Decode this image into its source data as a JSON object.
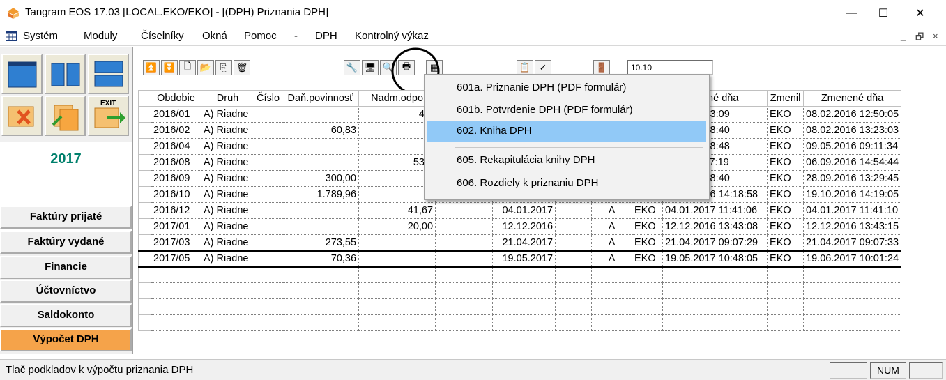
{
  "window": {
    "title": "Tangram EOS 17.03 [LOCAL.EKO/EKO] - [(DPH) Priznania DPH]",
    "minimize": "—",
    "maximize": "☐",
    "close": "✕"
  },
  "menu": {
    "items": [
      "Systém",
      "Moduly",
      "Číselníky",
      "Okná",
      "Pomoc",
      "-",
      "DPH",
      "Kontrolný výkaz"
    ],
    "mdi": [
      "_",
      "🗗",
      "×"
    ]
  },
  "sidebar": {
    "year": "2017",
    "exit_label": "EXIT",
    "nav": [
      "Faktúry prijaté",
      "Faktúry vydané",
      "Financie",
      "Účtovníctvo",
      "Saldokonto",
      "Výpočet DPH"
    ],
    "active_index": 5,
    "active_color": "#f5a34a"
  },
  "toolbar": {
    "field_value": "10.10"
  },
  "table": {
    "headers": [
      "Obdobie",
      "Druh",
      "Číslo",
      "Daň.povinnosť",
      "Nadm.odpo",
      "",
      "",
      "",
      "",
      "",
      "ožené dňa",
      "Zmenil",
      "Zmenené dňa"
    ],
    "rows": [
      [
        "2016/01",
        "A) Riadne",
        "",
        "",
        "44,",
        "",
        "",
        "",
        "",
        "",
        "2016 08:53:09",
        "EKO",
        "08.02.2016 12:50:05"
      ],
      [
        "2016/02",
        "A) Riadne",
        "",
        "60,83",
        "",
        "",
        "",
        "",
        "",
        "",
        "2016 09:58:40",
        "EKO",
        "08.02.2016 13:23:03"
      ],
      [
        "2016/04",
        "A) Riadne",
        "",
        "",
        "8,",
        "",
        "",
        "",
        "",
        "",
        "2016 08:48:48",
        "EKO",
        "09.05.2016 09:11:34"
      ],
      [
        "2016/08",
        "A) Riadne",
        "",
        "",
        "533,",
        "",
        "",
        "",
        "",
        "",
        "2016 11:37:19",
        "EKO",
        "06.09.2016 14:54:44"
      ],
      [
        "2016/09",
        "A) Riadne",
        "",
        "300,00",
        "",
        "",
        "",
        "",
        "",
        "",
        "2016 13:28:40",
        "EKO",
        "28.09.2016 13:29:45"
      ],
      [
        "2016/10",
        "A) Riadne",
        "",
        "1.789,96",
        "",
        "",
        "19.10.2016",
        "",
        "A",
        "EKO",
        "19.10.2016 14:18:58",
        "EKO",
        "19.10.2016 14:19:05"
      ],
      [
        "2016/12",
        "A) Riadne",
        "",
        "",
        "41,67",
        "",
        "04.01.2017",
        "",
        "A",
        "EKO",
        "04.01.2017 11:41:06",
        "EKO",
        "04.01.2017 11:41:10"
      ],
      [
        "2017/01",
        "A) Riadne",
        "",
        "",
        "20,00",
        "",
        "12.12.2016",
        "",
        "A",
        "EKO",
        "12.12.2016 13:43:08",
        "EKO",
        "12.12.2016 13:43:15"
      ],
      [
        "2017/03",
        "A) Riadne",
        "",
        "273,55",
        "",
        "",
        "21.04.2017",
        "",
        "A",
        "EKO",
        "21.04.2017 09:07:29",
        "EKO",
        "21.04.2017 09:07:33"
      ],
      [
        "2017/05",
        "A) Riadne",
        "",
        "70,36",
        "",
        "",
        "19.05.2017",
        "",
        "A",
        "EKO",
        "19.05.2017 10:48:05",
        "EKO",
        "19.06.2017 10:01:24"
      ]
    ],
    "current_row": 9,
    "empty_rows": 4
  },
  "popup": {
    "items": [
      "601a. Priznanie DPH (PDF formulár)",
      "601b. Potvrdenie DPH (PDF formulár)",
      "602. Kniha DPH",
      "605. Rekapitulácia knihy DPH",
      "606. Rozdiely k priznaniu DPH"
    ],
    "highlighted_index": 2
  },
  "status": {
    "text": "Tlač podkladov k výpočtu priznania DPH",
    "num": "NUM"
  }
}
